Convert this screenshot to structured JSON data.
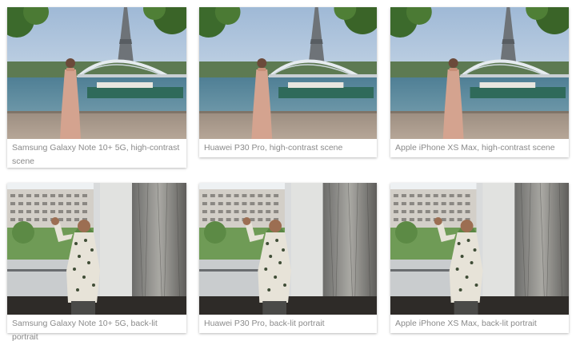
{
  "gallery": {
    "items": [
      {
        "caption": "Samsung Galaxy Note 10+ 5G, high-contrast scene",
        "scene": "paris-riverside-eiffel-tower"
      },
      {
        "caption": "Huawei P30 Pro, high-contrast scene",
        "scene": "paris-riverside-eiffel-tower"
      },
      {
        "caption": "Apple iPhone XS Max, high-contrast scene",
        "scene": "paris-riverside-eiffel-tower"
      },
      {
        "caption": "Samsung Galaxy Note 10+ 5G, back-lit portrait",
        "scene": "man-waving-by-window"
      },
      {
        "caption": "Huawei P30 Pro, back-lit portrait",
        "scene": "man-waving-by-window"
      },
      {
        "caption": "Apple iPhone XS Max, back-lit portrait",
        "scene": "man-waving-by-window"
      }
    ]
  },
  "colors": {
    "caption_text": "#8a8a8a",
    "card_background": "#ffffff"
  }
}
